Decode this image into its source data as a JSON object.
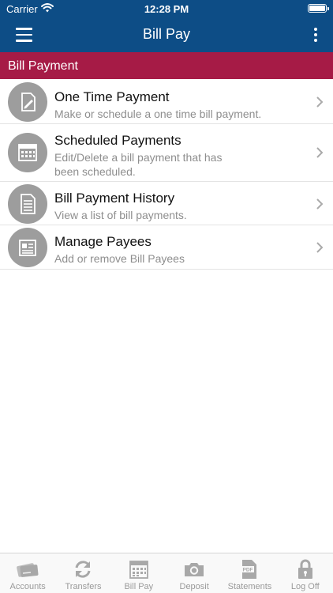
{
  "status_bar": {
    "carrier": "Carrier",
    "time": "12:28 PM"
  },
  "nav": {
    "title": "Bill Pay"
  },
  "section": {
    "title": "Bill Payment"
  },
  "menu": {
    "items": [
      {
        "title": "One Time Payment",
        "description": "Make or schedule a one time bill payment.",
        "icon": "edit-document-icon"
      },
      {
        "title": "Scheduled Payments",
        "description_line1": "Edit/Delete a bill payment that has",
        "description_line2": "been scheduled.",
        "icon": "calendar-icon"
      },
      {
        "title": "Bill Payment History",
        "description": "View a list of bill payments.",
        "icon": "document-list-icon"
      },
      {
        "title": "Manage Payees",
        "description": "Add or remove Bill Payees",
        "icon": "payee-card-icon"
      }
    ]
  },
  "tabs": [
    {
      "label": "Accounts",
      "icon": "cards-icon"
    },
    {
      "label": "Transfers",
      "icon": "refresh-icon"
    },
    {
      "label": "Bill Pay",
      "icon": "calendar-icon"
    },
    {
      "label": "Deposit",
      "icon": "camera-icon"
    },
    {
      "label": "Statements",
      "icon": "pdf-icon"
    },
    {
      "label": "Log Off",
      "icon": "lock-icon"
    }
  ],
  "colors": {
    "nav_bg": "#0d4d86",
    "section_bg": "#a61b46",
    "icon_gray": "#9d9d9d",
    "tab_gray": "#9a9a9a"
  }
}
